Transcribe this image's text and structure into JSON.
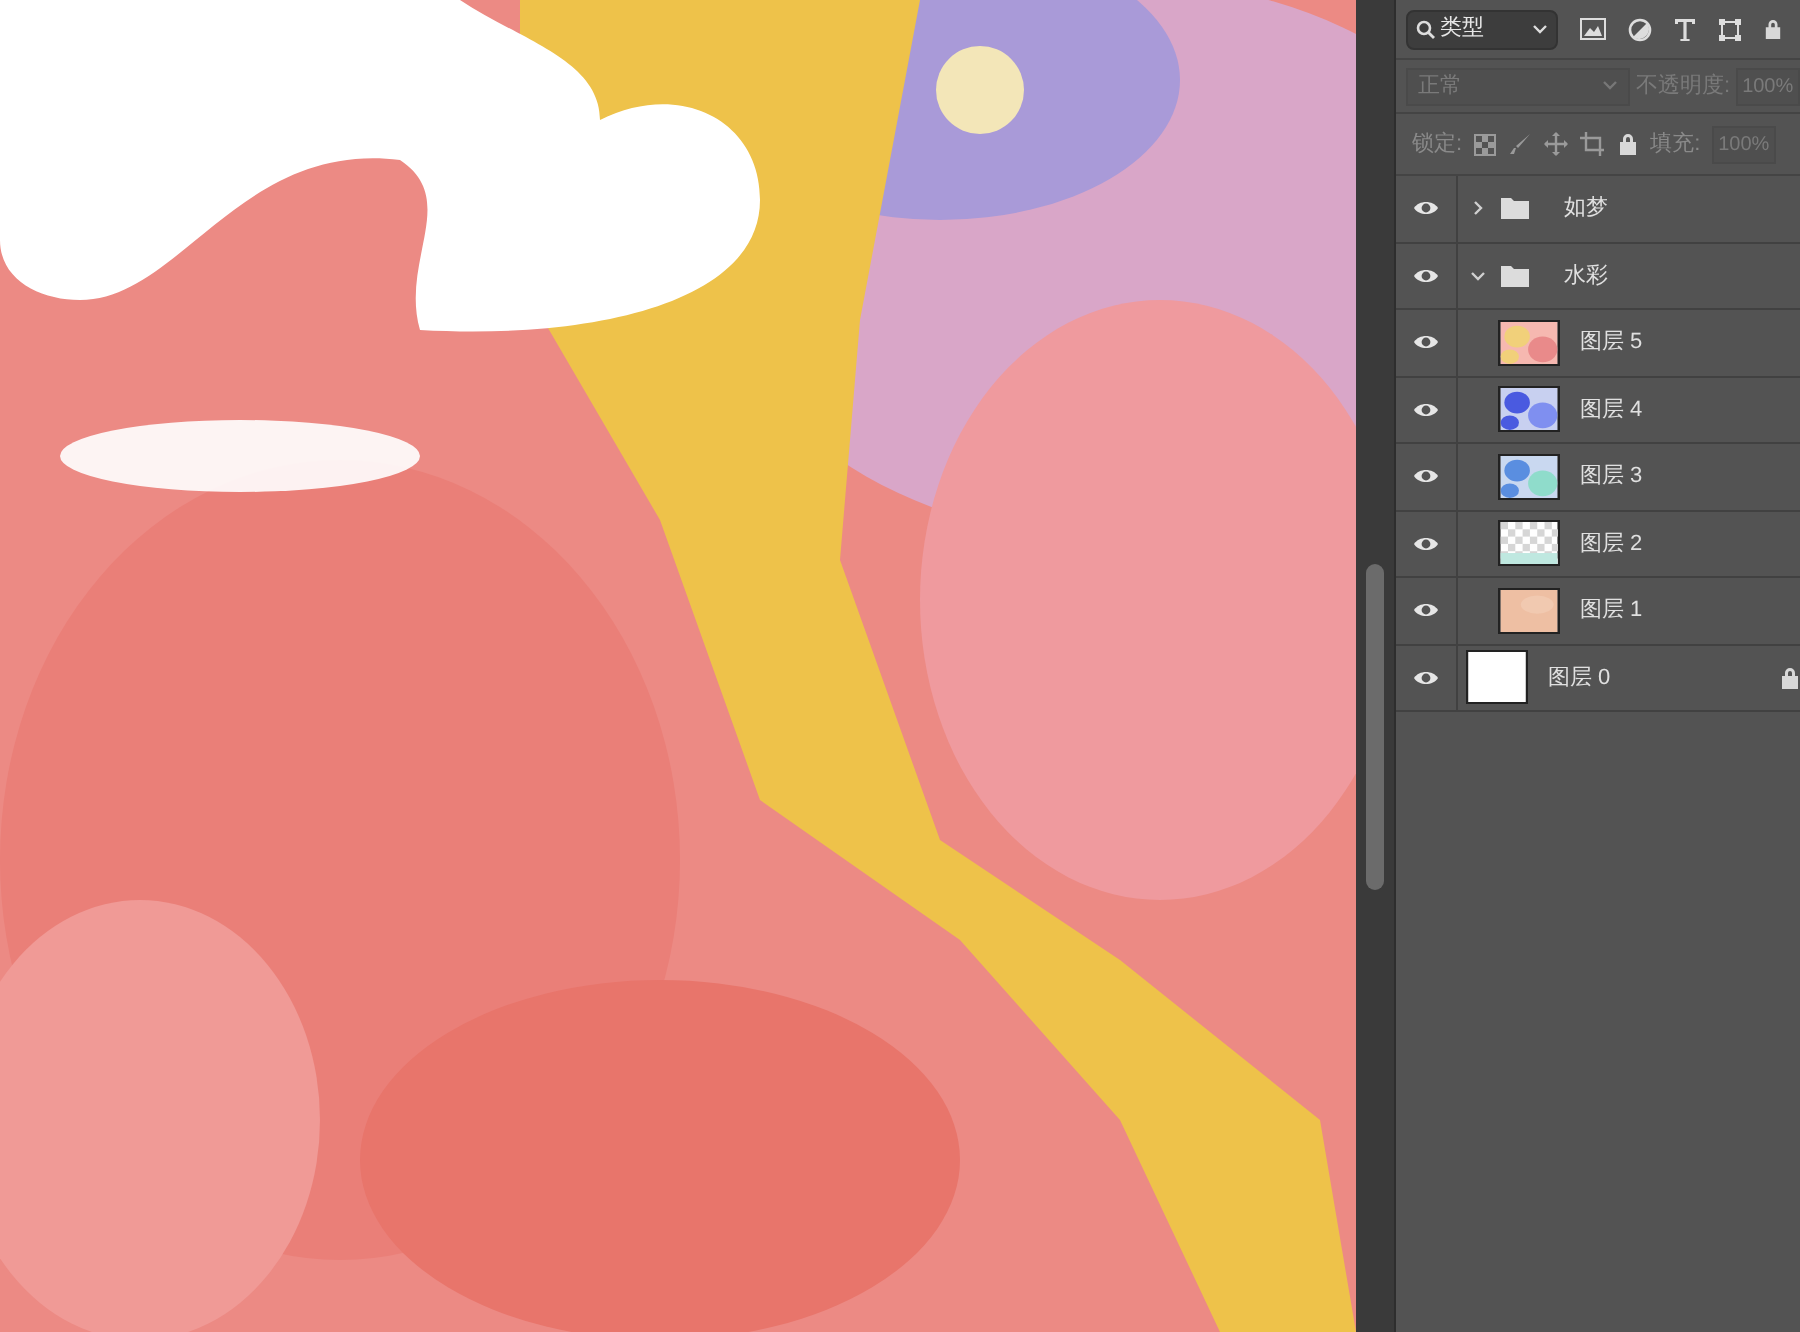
{
  "filter_bar": {
    "filter": "类型"
  },
  "blend_bar": {
    "mode": "正常",
    "mode_disabled": true,
    "opacity_label": "不透明度:",
    "opacity": "100%"
  },
  "lock_bar": {
    "label": "锁定:",
    "fill_label": "填充:",
    "fill": "100%"
  },
  "layers": [
    {
      "kind": "group",
      "name": "如梦",
      "visible": true,
      "expanded": false,
      "locked": false
    },
    {
      "kind": "group",
      "name": "水彩",
      "visible": true,
      "expanded": true,
      "locked": false,
      "children": [
        {
          "kind": "layer",
          "name": "图层 5",
          "visible": true,
          "locked": false
        },
        {
          "kind": "layer",
          "name": "图层 4",
          "visible": true,
          "locked": false
        },
        {
          "kind": "layer",
          "name": "图层 3",
          "visible": true,
          "locked": false
        },
        {
          "kind": "layer",
          "name": "图层 2",
          "visible": true,
          "locked": false
        },
        {
          "kind": "layer",
          "name": "图层 1",
          "visible": true,
          "locked": false
        }
      ]
    },
    {
      "kind": "layer",
      "name": "图层 0",
      "visible": true,
      "locked": true
    }
  ]
}
